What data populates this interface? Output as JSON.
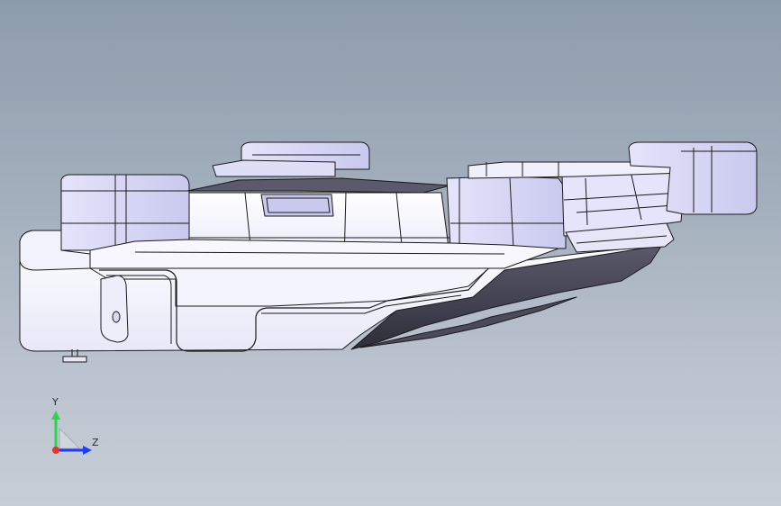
{
  "viewport": {
    "background_top": "#8d9cab",
    "background_bottom": "#c6cdd6"
  },
  "model": {
    "face_color": "#ffffff",
    "shade_color": "#dcdcf4",
    "dark_color": "#3c3c4c",
    "edge_color": "#1a1a1a"
  },
  "triad": {
    "y_label": "Y",
    "z_label": "Z",
    "y_color": "#2ed34a",
    "z_color": "#1e3cff",
    "x_color": "#e8322e"
  }
}
